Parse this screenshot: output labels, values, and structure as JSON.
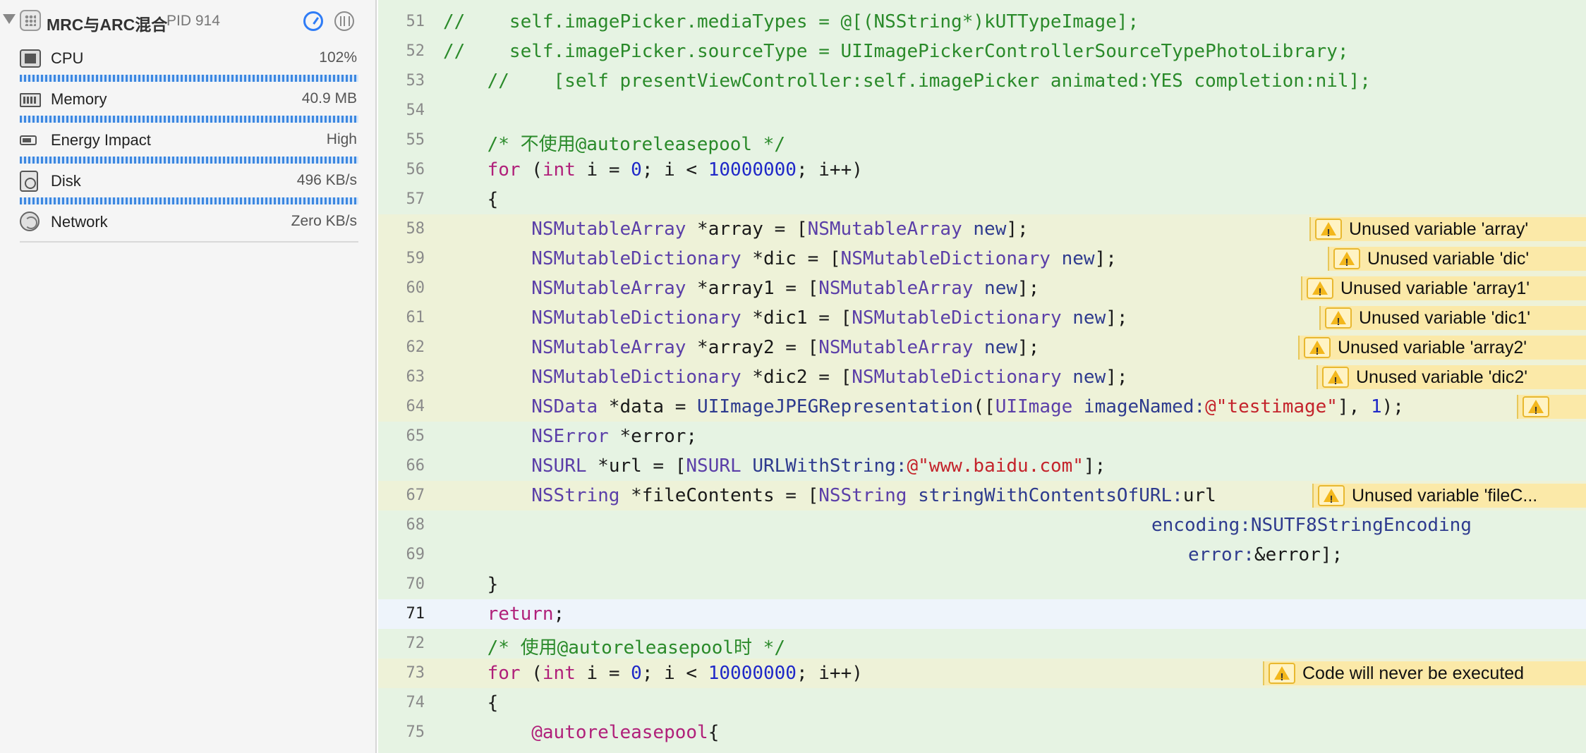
{
  "debug_navigator": {
    "process": {
      "name": "MRC与ARC混合",
      "pid": "PID 914"
    },
    "gauges": [
      {
        "label": "CPU",
        "value": "102%",
        "icon": "cpu-icon"
      },
      {
        "label": "Memory",
        "value": "40.9 MB",
        "icon": "memory-icon"
      },
      {
        "label": "Energy Impact",
        "value": "High",
        "icon": "energy-icon"
      },
      {
        "label": "Disk",
        "value": "496 KB/s",
        "icon": "disk-icon"
      },
      {
        "label": "Network",
        "value": "Zero KB/s",
        "icon": "network-icon"
      }
    ]
  },
  "editor": {
    "lines": [
      {
        "n": "51"
      },
      {
        "n": "52"
      },
      {
        "n": "53"
      },
      {
        "n": "54"
      },
      {
        "n": "55"
      },
      {
        "n": "56"
      },
      {
        "n": "57"
      },
      {
        "n": "58"
      },
      {
        "n": "59"
      },
      {
        "n": "60"
      },
      {
        "n": "61"
      },
      {
        "n": "62"
      },
      {
        "n": "63"
      },
      {
        "n": "64"
      },
      {
        "n": "65"
      },
      {
        "n": "66"
      },
      {
        "n": "67"
      },
      {
        "n": "68"
      },
      {
        "n": "69"
      },
      {
        "n": "70"
      },
      {
        "n": "71"
      },
      {
        "n": "72"
      },
      {
        "n": "73"
      },
      {
        "n": "74"
      },
      {
        "n": "75"
      }
    ],
    "code": {
      "l51": "//    self.imagePicker.mediaTypes = @[(NSString*)kUTTypeImage];",
      "l52": "//    self.imagePicker.sourceType = UIImagePickerControllerSourceTypePhotoLibrary;",
      "l53": "    //    [self presentViewController:self.imagePicker animated:YES completion:nil];",
      "l55": "    /* 不使用@autoreleasepool */",
      "l56_kw": "for",
      "l56_a": " (",
      "l56_int": "int",
      "l56_b": " i = ",
      "l56_zero": "0",
      "l56_c": "; i < ",
      "l56_max": "10000000",
      "l56_d": "; i++)",
      "l57": "{",
      "l58_cls": "NSMutableArray",
      "l58_a": " *array = [",
      "l58_cls2": "NSMutableArray",
      "l58_m": " new",
      "l58_b": "];",
      "l59_cls": "NSMutableDictionary",
      "l59_a": " *dic = [",
      "l59_cls2": "NSMutableDictionary",
      "l59_m": " new",
      "l59_b": "];",
      "l60_cls": "NSMutableArray",
      "l60_a": " *array1 = [",
      "l60_cls2": "NSMutableArray",
      "l60_m": " new",
      "l60_b": "];",
      "l61_cls": "NSMutableDictionary",
      "l61_a": " *dic1 = [",
      "l61_cls2": "NSMutableDictionary",
      "l61_m": " new",
      "l61_b": "];",
      "l62_cls": "NSMutableArray",
      "l62_a": " *array2 = [",
      "l62_cls2": "NSMutableArray",
      "l62_m": " new",
      "l62_b": "];",
      "l63_cls": "NSMutableDictionary",
      "l63_a": " *dic2 = [",
      "l63_cls2": "NSMutableDictionary",
      "l63_m": " new",
      "l63_b": "];",
      "l64_cls": "NSData",
      "l64_a": " *data = ",
      "l64_fn": "UIImageJPEGRepresentation",
      "l64_b": "([",
      "l64_cls2": "UIImage",
      "l64_m": " imageNamed:",
      "l64_str": "@\"testimage\"",
      "l64_c": "], ",
      "l64_one": "1",
      "l64_d": ");",
      "l65_cls": "NSError",
      "l65_a": " *error;",
      "l66_cls": "NSURL",
      "l66_a": " *url = [",
      "l66_cls2": "NSURL",
      "l66_m": " URLWithString:",
      "l66_str": "@\"www.baidu.com\"",
      "l66_b": "];",
      "l67_cls": "NSString",
      "l67_a": " *fileContents = [",
      "l67_cls2": "NSString",
      "l67_m": " stringWithContentsOfURL:",
      "l67_b": "url",
      "l68_m": "encoding:",
      "l68_c": "NSUTF8StringEncoding",
      "l69_m": "error:",
      "l69_a": "&error];",
      "l70": "}",
      "l71_kw": "return",
      "l71_a": ";",
      "l72": "    /* 使用@autoreleasepool时 */",
      "l73_kw": "for",
      "l73_a": " (",
      "l73_int": "int",
      "l73_b": " i = ",
      "l73_zero": "0",
      "l73_c": "; i < ",
      "l73_max": "10000000",
      "l73_d": "; i++)",
      "l74": "{",
      "l75_at": "@autoreleasepool",
      "l75_a": "{"
    },
    "issues": {
      "i58": "Unused variable 'array'",
      "i59": "Unused variable 'dic'",
      "i60": "Unused variable 'array1'",
      "i61": "Unused variable 'dic1'",
      "i62": "Unused variable 'array2'",
      "i63": "Unused variable 'dic2'",
      "i67": "Unused variable 'fileC...",
      "i73": "Code will never be executed"
    }
  }
}
